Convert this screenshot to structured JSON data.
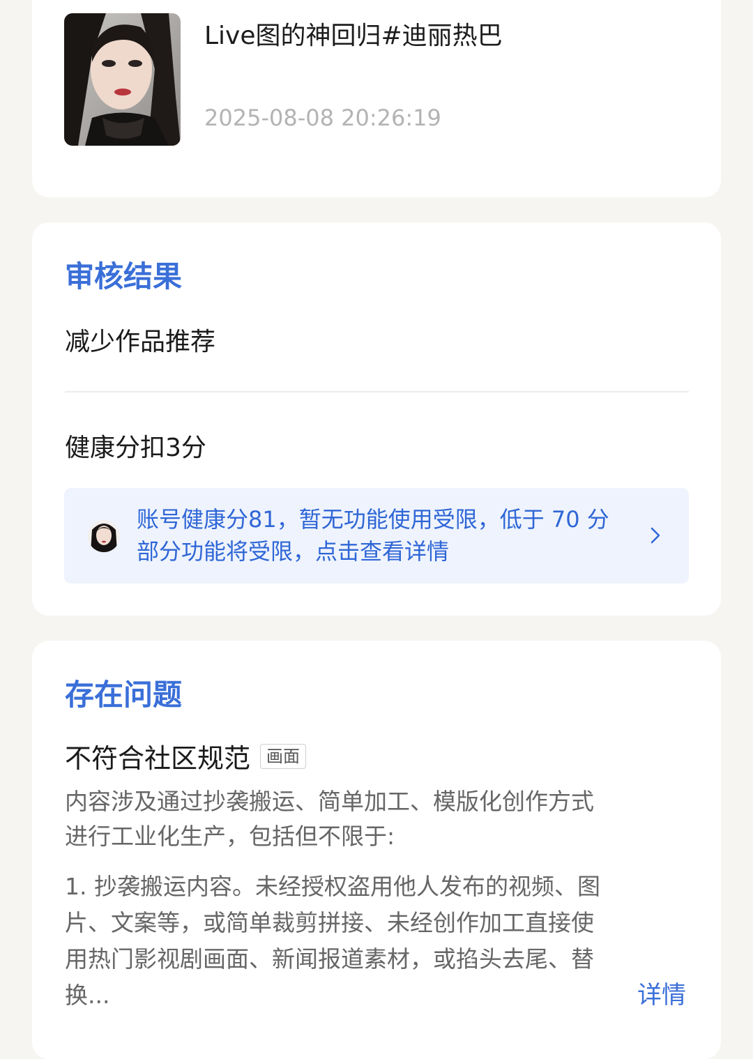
{
  "post": {
    "title": "Live图的神回归#迪丽热巴",
    "timestamp": "2025-08-08 20:26:19"
  },
  "review": {
    "section_title": "审核结果",
    "result": "减少作品推荐",
    "penalty": "健康分扣3分",
    "notice_line1": "账号健康分81，暂无功能使用受限，低于 70 分",
    "notice_line2": "部分功能将受限，点击查看详情"
  },
  "issues": {
    "section_title": "存在问题",
    "name": "不符合社区规范",
    "tag": "画面",
    "desc_line1": "内容涉及通过抄袭搬运、简单加工、模版化创作方式",
    "desc_line2": "进行工业化生产，包括但不限于:",
    "item_line1": "1. 抄袭搬运内容。未经授权盗用他人发布的视频、图",
    "item_line2": "片、文案等，或简单裁剪拼接、未经创作加工直接使",
    "item_line3": "用热门影视剧画面、新闻报道素材，或掐头去尾、替",
    "item_line4": "换...",
    "detail_link": "详情"
  }
}
